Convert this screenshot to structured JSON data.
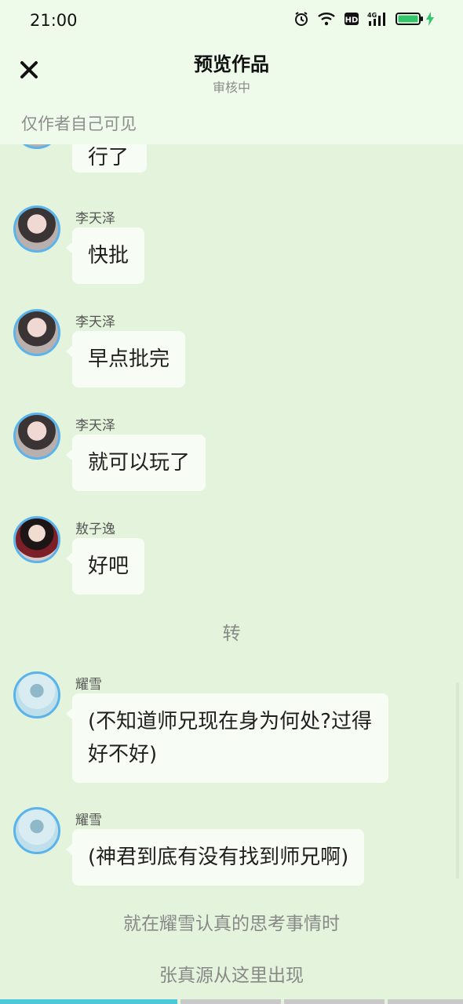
{
  "status": {
    "time": "21:00"
  },
  "header": {
    "title": "预览作品",
    "subtitle": "审核中",
    "visibility": "仅作者自己可见"
  },
  "messages": [
    {
      "sender": "",
      "text": "行了"
    },
    {
      "sender": "李天泽",
      "text": "快批"
    },
    {
      "sender": "李天泽",
      "text": "早点批完"
    },
    {
      "sender": "李天泽",
      "text": "就可以玩了"
    },
    {
      "sender": "敖子逸",
      "text": "好吧"
    },
    {
      "sender": "耀雪",
      "text": "(不知道师兄现在身为何处?过得好不好)"
    },
    {
      "sender": "耀雪",
      "text": "(神君到底有没有找到师兄啊)"
    }
  ],
  "narrations": [
    "转",
    "就在耀雪认真的思考事情时",
    "张真源从这里出现"
  ],
  "icons": [
    "close-icon",
    "alarm-icon",
    "wifi-icon",
    "hd-icon",
    "signal-4g-icon",
    "battery-icon",
    "charging-icon"
  ],
  "colors": {
    "background": "#e4f4dc",
    "header": "#effbea",
    "bubble": "#f7fdf4",
    "avatar_ring": "#5ab3ea",
    "progress_active": "#4cc9d6"
  },
  "progress": {
    "segments": 4,
    "active": 1
  }
}
